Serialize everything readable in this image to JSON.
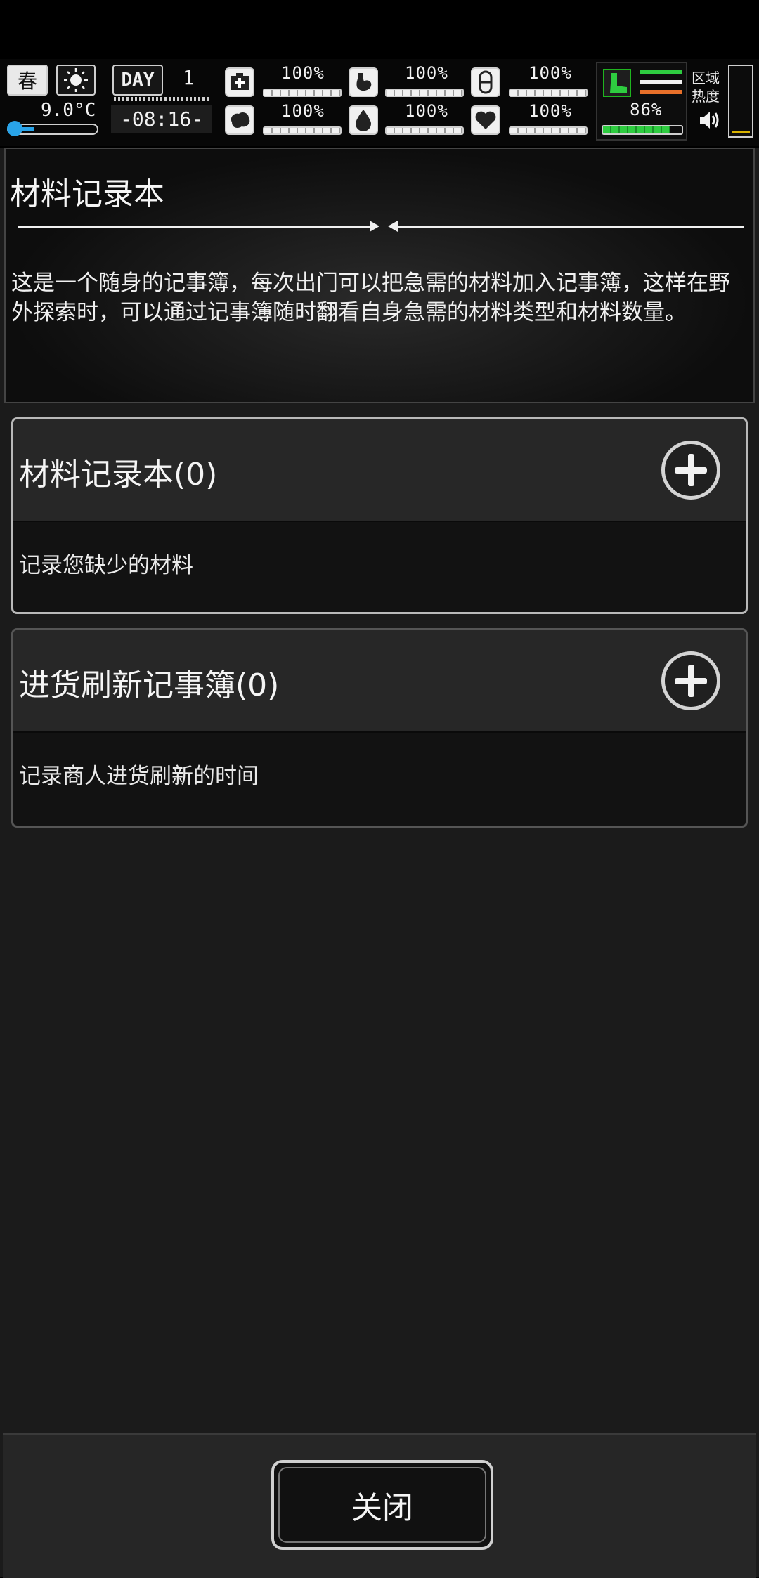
{
  "hud": {
    "season": "春",
    "temperature": "9.0°C",
    "day_label": "DAY",
    "day_number": "1",
    "clock": "-08:16-",
    "stats": [
      {
        "icon": "medkit-icon",
        "value": "100%",
        "fill": 1.0
      },
      {
        "icon": "stomach-icon",
        "value": "100%",
        "fill": 1.0
      },
      {
        "icon": "pill-icon",
        "value": "100%",
        "fill": 1.0
      },
      {
        "icon": "brain-icon",
        "value": "100%",
        "fill": 1.0
      },
      {
        "icon": "water-drop-icon",
        "value": "100%",
        "fill": 1.0
      },
      {
        "icon": "heart-icon",
        "value": "100%",
        "fill": 1.0
      }
    ],
    "stamina_value": "86%",
    "stamina_fill": 0.86,
    "zone_label_line1": "区域",
    "zone_label_line2": "热度",
    "colors": {
      "green": "#2ecc40",
      "orange": "#e8702a",
      "blue": "#29a3e8"
    }
  },
  "header": {
    "title": "材料记录本",
    "description": "这是一个随身的记事簿，每次出门可以把急需的材料加入记事簿，这样在野外探索时，可以通过记事簿随时翻看自身急需的材料类型和材料数量。"
  },
  "cards": [
    {
      "title": "材料记录本(0)",
      "subtitle": "记录您缺少的材料"
    },
    {
      "title": "进货刷新记事簿(0)",
      "subtitle": "记录商人进货刷新的时间"
    }
  ],
  "footer": {
    "close_label": "关闭"
  }
}
